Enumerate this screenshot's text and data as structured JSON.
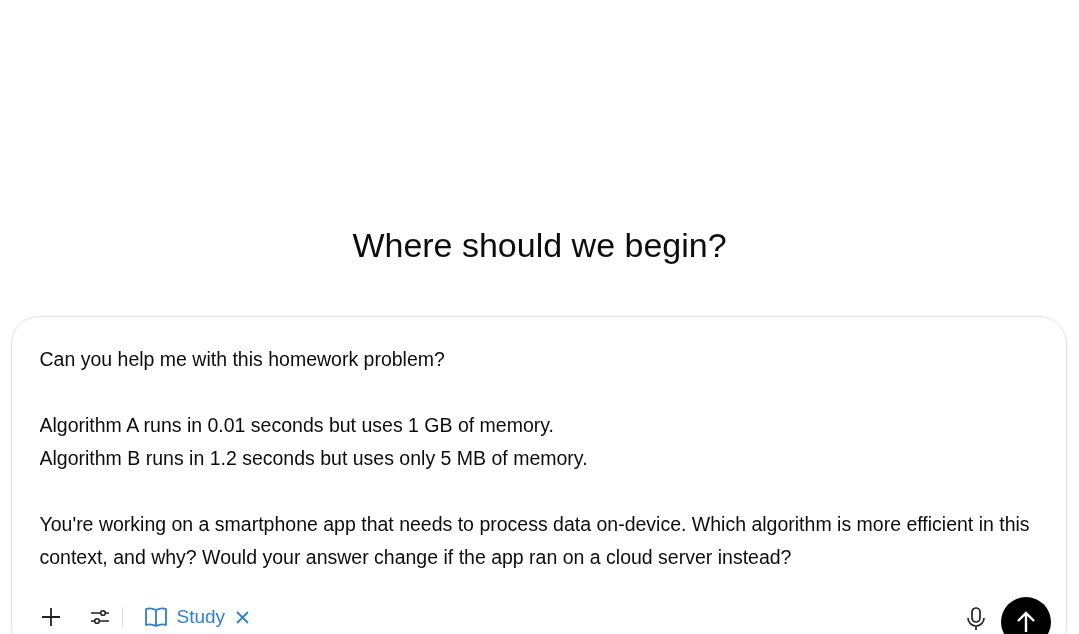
{
  "heading": "Where should we begin?",
  "composer": {
    "value": "Can you help me with this homework problem?\n\nAlgorithm A runs in 0.01 seconds but uses 1 GB of memory.\nAlgorithm B runs in 1.2 seconds but uses only 5 MB of memory.\n\nYou're working on a smartphone app that needs to process data on-device. Which algorithm is more efficient in this context, and why? Would your answer change if the app ran on a cloud server instead?",
    "chip": {
      "label": "Study"
    }
  }
}
